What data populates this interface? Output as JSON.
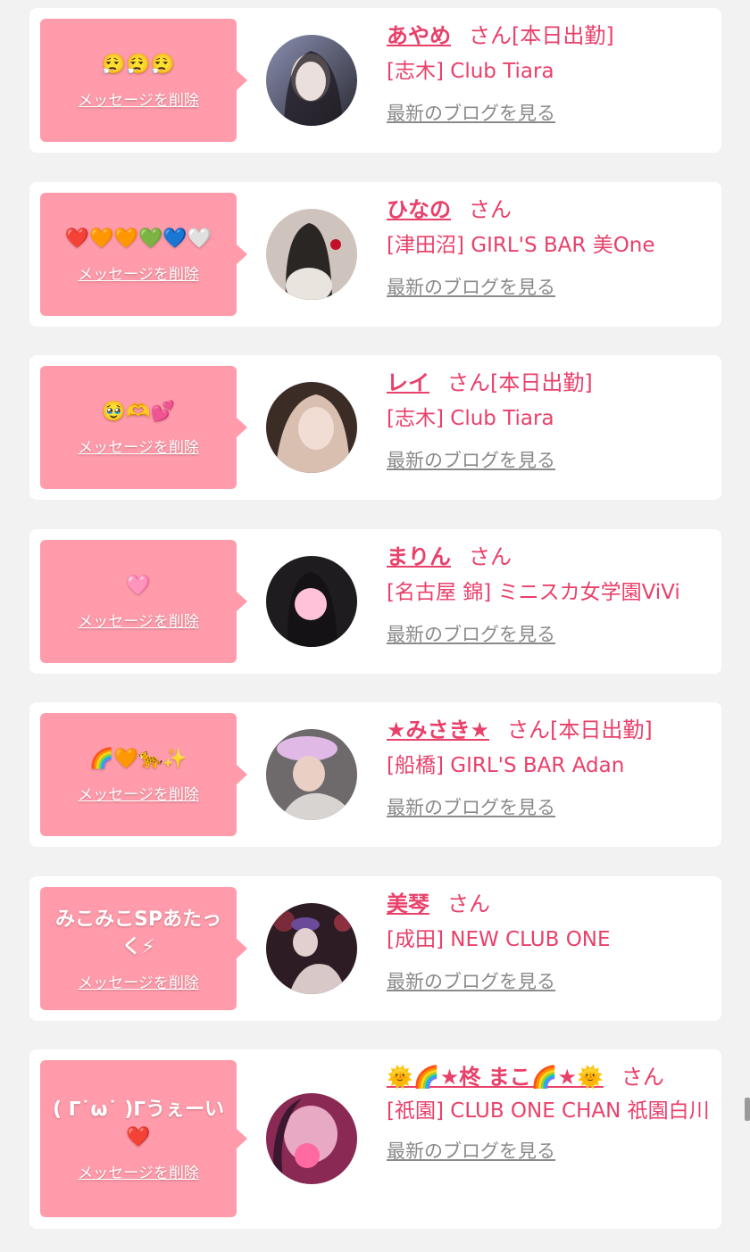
{
  "delete_label": "メッセージを削除",
  "blog_label": "最新のブログを見る",
  "colors": {
    "bubble": "#ff9bab",
    "accent": "#e9406a",
    "link_gray": "#8a8a8a"
  },
  "items": [
    {
      "message": "😮‍💨😮‍💨😮‍💨",
      "name": "あやめ",
      "suffix": "さん[本日出勤]",
      "shop": "[志木] Club Tiara",
      "avatar_icon": "avatar-photo"
    },
    {
      "message": "❤️🧡🧡💚💙🤍",
      "name": "ひなの",
      "suffix": "さん",
      "shop": "[津田沼] GIRL'S BAR 美One",
      "avatar_icon": "avatar-photo"
    },
    {
      "message": "🥹🫶💕",
      "name": "レイ",
      "suffix": "さん[本日出勤]",
      "shop": "[志木] Club Tiara",
      "avatar_icon": "avatar-photo"
    },
    {
      "message": "🩷",
      "name": "まりん",
      "suffix": "さん",
      "shop": "[名古屋 錦] ミニスカ女学園ViVi",
      "avatar_icon": "avatar-photo"
    },
    {
      "message": "🌈🧡🐆✨",
      "name": "★みさき★",
      "suffix": "さん[本日出勤]",
      "shop": "[船橋] GIRL'S BAR Adan",
      "avatar_icon": "avatar-photo"
    },
    {
      "message": "みこみこSPあたっく⚡",
      "name": "美琴",
      "suffix": "さん",
      "shop": "[成田] NEW CLUB ONE",
      "avatar_icon": "avatar-photo"
    },
    {
      "message": "( ᒥ˙ω˙ )ᒥうぇーい❤️",
      "name": "🌞🌈★柊 まこ🌈★🌞",
      "suffix": "さん",
      "shop": "[祇園] CLUB ONE CHAN 祇園白川",
      "avatar_icon": "avatar-photo"
    }
  ]
}
